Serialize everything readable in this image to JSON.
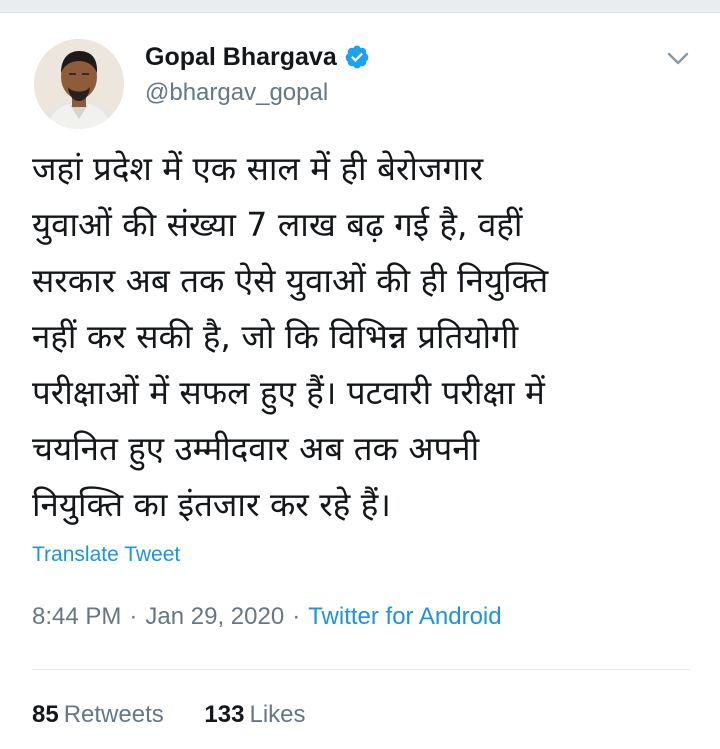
{
  "tweet": {
    "author": {
      "name": "Gopal Bhargava",
      "handle": "@bhargav_gopal",
      "verified": true
    },
    "text_lines": [
      "जहां प्रदेश में एक साल में ही बेरोजगार",
      "युवाओं की संख्या 7 लाख बढ़ गई है, वहीं",
      "सरकार अब तक ऐसे युवाओं की ही नियुक्ति",
      "नहीं कर सकी है, जो कि विभिन्न प्रतियोगी",
      "परीक्षाओं में सफल हुए हैं। पटवारी परीक्षा में",
      "चयनित हुए उम्मीदवार अब तक अपनी",
      "नियुक्ति का इंतजार कर रहे हैं।"
    ],
    "translate_label": "Translate Tweet",
    "time": "8:44 PM",
    "date": "Jan 29, 2020",
    "separator": "·",
    "source": "Twitter for Android",
    "stats": {
      "retweets_count": "85",
      "retweets_label": "Retweets",
      "likes_count": "133",
      "likes_label": "Likes"
    }
  },
  "icons": {
    "verified": "verified-badge-icon",
    "menu": "chevron-down-icon"
  },
  "colors": {
    "link_blue": "#1b95e0",
    "secondary_text": "#657786",
    "primary_text": "#14171a",
    "divider": "#e6ecf0"
  }
}
